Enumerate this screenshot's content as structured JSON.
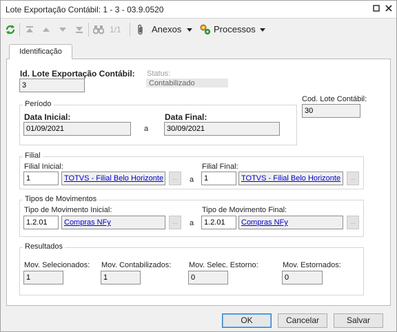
{
  "window": {
    "title": "Lote Exportação Contábil: 1 - 3 - 03.9.0520"
  },
  "toolbar": {
    "record_position": "1/1",
    "attachments_label": "Anexos",
    "processes_label": "Processos"
  },
  "tabs": [
    {
      "label": "Identificação"
    }
  ],
  "form": {
    "lote_id_label": "Id. Lote Exportação Contábil:",
    "lote_id_value": "3",
    "status_label": "Status:",
    "status_value": "Contabilizado",
    "periodo": {
      "group_label": "Período",
      "data_inicial_label": "Data Inicial:",
      "data_inicial_value": "01/09/2021",
      "separator": "a",
      "data_final_label": "Data Final:",
      "data_final_value": "30/09/2021"
    },
    "cod_lote_label": "Cod. Lote Contábil:",
    "cod_lote_value": "30",
    "filial": {
      "group_label": "Filial",
      "inicial_label": "Filial Inicial:",
      "inicial_code": "1",
      "inicial_name": "TOTVS - Filial Belo Horizonte",
      "separator": "a",
      "final_label": "Filial Final:",
      "final_code": "1",
      "final_name": "TOTVS - Filial Belo Horizonte",
      "lookup_label": "..."
    },
    "movimentos": {
      "group_label": "Tipos de Movimentos",
      "inicial_label": "Tipo de Movimento Inicial:",
      "inicial_code": "1.2.01",
      "inicial_name": "Compras NFy",
      "separator": "a",
      "final_label": "Tipo de Movimento Final:",
      "final_code": "1.2.01",
      "final_name": "Compras NFy",
      "lookup_label": "..."
    },
    "resultados": {
      "group_label": "Resultados",
      "selecionados_label": "Mov. Selecionados:",
      "selecionados_value": "1",
      "contabilizados_label": "Mov. Contabilizados:",
      "contabilizados_value": "1",
      "selec_estorno_label": "Mov. Selec. Estorno:",
      "selec_estorno_value": "0",
      "estornados_label": "Mov. Estornados:",
      "estornados_value": "0"
    }
  },
  "buttons": {
    "ok": "OK",
    "cancel": "Cancelar",
    "save": "Salvar"
  },
  "colors": {
    "link": "#0000cc",
    "primary_border": "#3c7fb1",
    "refresh_icon": "#2e9a2e"
  }
}
